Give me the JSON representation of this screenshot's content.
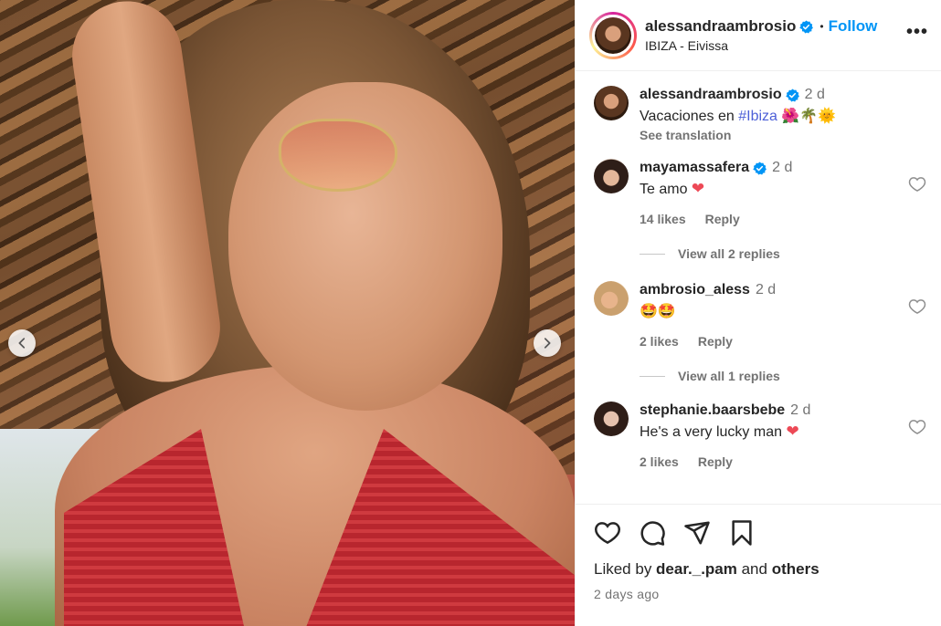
{
  "header": {
    "username": "alessandraambrosio",
    "dot": "•",
    "follow_label": "Follow",
    "location": "IBIZA - Eivissa",
    "more_label": "•••"
  },
  "caption": {
    "username": "alessandraambrosio",
    "time": "2 d",
    "text_prefix": "Vacaciones en ",
    "hashtag": "#Ibiza",
    "emojis": "🌺🌴🌞",
    "see_translation": "See translation"
  },
  "comments": [
    {
      "username": "mayamassafera",
      "verified": true,
      "time": "2 d",
      "text": "Te amo",
      "emoji": "❤",
      "likes": "14 likes",
      "reply": "Reply",
      "view_replies": "View all 2 replies"
    },
    {
      "username": "ambrosio_aless",
      "verified": false,
      "time": "2 d",
      "text": "",
      "emoji": "🤩🤩",
      "likes": "2 likes",
      "reply": "Reply",
      "view_replies": "View all 1 replies"
    },
    {
      "username": "stephanie.baarsbebe",
      "verified": false,
      "time": "2 d",
      "text": "He's a very lucky man",
      "emoji": "❤",
      "likes": "2 likes",
      "reply": "Reply",
      "view_replies": ""
    }
  ],
  "footer": {
    "liked_prefix": "Liked by ",
    "liked_user": "dear._.pam",
    "liked_and": " and ",
    "liked_others": "others",
    "date": "2 days ago"
  },
  "colors": {
    "follow_blue": "#0095f6",
    "verified_blue": "#0095f6",
    "heart_red": "#ed4956",
    "muted_gray": "#737373"
  },
  "icons": [
    "chevron-left-icon",
    "chevron-right-icon",
    "verified-badge-icon",
    "heart-icon",
    "comment-icon",
    "share-icon",
    "bookmark-icon"
  ]
}
